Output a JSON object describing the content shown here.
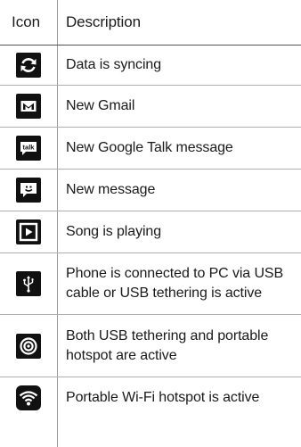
{
  "header": {
    "icon_col": "Icon",
    "desc_col": "Description"
  },
  "rows": [
    {
      "icon": "sync-icon",
      "description": "Data is syncing"
    },
    {
      "icon": "gmail-icon",
      "description": "New Gmail"
    },
    {
      "icon": "google-talk-icon",
      "description": "New Google Talk message"
    },
    {
      "icon": "message-icon",
      "description": "New message"
    },
    {
      "icon": "play-icon",
      "description": "Song is playing"
    },
    {
      "icon": "usb-icon",
      "description": "Phone is connected to PC via USB cable or USB tethering is active"
    },
    {
      "icon": "tethering-hotspot-icon",
      "description": "Both USB tethering and portable hotspot are active"
    },
    {
      "icon": "wifi-hotspot-icon",
      "description": "Portable Wi-Fi hotspot is active"
    }
  ],
  "icon_glyphs": {
    "talk": "talk"
  }
}
